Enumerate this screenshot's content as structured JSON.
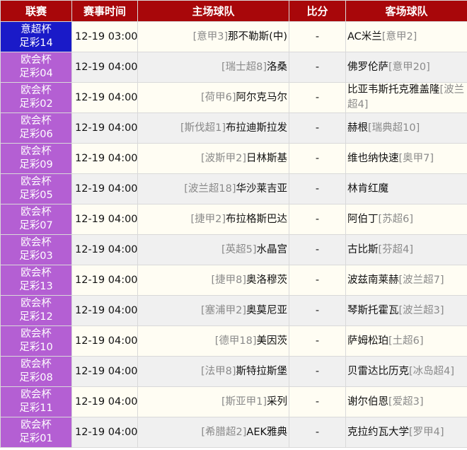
{
  "headers": [
    "联赛",
    "赛事时间",
    "主场球队",
    "比分",
    "客场球队"
  ],
  "colors": {
    "header": "#a8070a",
    "league_italy": "#1a1ac8",
    "league_conference": "#b45fd3"
  },
  "matches": [
    {
      "league": "意超杯",
      "lottery": "足彩14",
      "league_color": "#1a1ac8",
      "time": "12-19 03:00",
      "home_rank": "[意甲3]",
      "home": "那不勒斯(中)",
      "score": "-",
      "away": "AC米兰",
      "away_rank": "[意甲2]"
    },
    {
      "league": "欧会杯",
      "lottery": "足彩04",
      "league_color": "#b45fd3",
      "time": "12-19 04:00",
      "home_rank": "[瑞士超8]",
      "home": "洛桑",
      "score": "-",
      "away": "佛罗伦萨",
      "away_rank": "[意甲20]"
    },
    {
      "league": "欧会杯",
      "lottery": "足彩02",
      "league_color": "#b45fd3",
      "time": "12-19 04:00",
      "home_rank": "[荷甲6]",
      "home": "阿尔克马尔",
      "score": "-",
      "away": "比亚韦斯托克雅盖隆",
      "away_rank": "[波兰超4]"
    },
    {
      "league": "欧会杯",
      "lottery": "足彩06",
      "league_color": "#b45fd3",
      "time": "12-19 04:00",
      "home_rank": "[斯伐超1]",
      "home": "布拉迪斯拉发",
      "score": "-",
      "away": "赫根",
      "away_rank": "[瑞典超10]"
    },
    {
      "league": "欧会杯",
      "lottery": "足彩09",
      "league_color": "#b45fd3",
      "time": "12-19 04:00",
      "home_rank": "[波斯甲2]",
      "home": "日林斯基",
      "score": "-",
      "away": "维也纳快速",
      "away_rank": "[奥甲7]"
    },
    {
      "league": "欧会杯",
      "lottery": "足彩05",
      "league_color": "#b45fd3",
      "time": "12-19 04:00",
      "home_rank": "[波兰超18]",
      "home": "华沙莱吉亚",
      "score": "-",
      "away": "林肯红魔",
      "away_rank": ""
    },
    {
      "league": "欧会杯",
      "lottery": "足彩07",
      "league_color": "#b45fd3",
      "time": "12-19 04:00",
      "home_rank": "[捷甲2]",
      "home": "布拉格斯巴达",
      "score": "-",
      "away": "阿伯丁",
      "away_rank": "[苏超6]"
    },
    {
      "league": "欧会杯",
      "lottery": "足彩03",
      "league_color": "#b45fd3",
      "time": "12-19 04:00",
      "home_rank": "[英超5]",
      "home": "水晶宫",
      "score": "-",
      "away": "古比斯",
      "away_rank": "[芬超4]"
    },
    {
      "league": "欧会杯",
      "lottery": "足彩13",
      "league_color": "#b45fd3",
      "time": "12-19 04:00",
      "home_rank": "[捷甲8]",
      "home": "奥洛穆茨",
      "score": "-",
      "away": "波兹南莱赫",
      "away_rank": "[波兰超7]"
    },
    {
      "league": "欧会杯",
      "lottery": "足彩12",
      "league_color": "#b45fd3",
      "time": "12-19 04:00",
      "home_rank": "[塞浦甲2]",
      "home": "奥莫尼亚",
      "score": "-",
      "away": "琴斯托霍瓦",
      "away_rank": "[波兰超3]"
    },
    {
      "league": "欧会杯",
      "lottery": "足彩10",
      "league_color": "#b45fd3",
      "time": "12-19 04:00",
      "home_rank": "[德甲18]",
      "home": "美因茨",
      "score": "-",
      "away": "萨姆松珀",
      "away_rank": "[土超6]"
    },
    {
      "league": "欧会杯",
      "lottery": "足彩08",
      "league_color": "#b45fd3",
      "time": "12-19 04:00",
      "home_rank": "[法甲8]",
      "home": "斯特拉斯堡",
      "score": "-",
      "away": "贝雷达比历克",
      "away_rank": "[冰岛超4]"
    },
    {
      "league": "欧会杯",
      "lottery": "足彩11",
      "league_color": "#b45fd3",
      "time": "12-19 04:00",
      "home_rank": "[斯亚甲1]",
      "home": "采列",
      "score": "-",
      "away": "谢尔伯恩",
      "away_rank": "[爱超3]"
    },
    {
      "league": "欧会杯",
      "lottery": "足彩01",
      "league_color": "#b45fd3",
      "time": "12-19 04:00",
      "home_rank": "[希腊超2]",
      "home": "AEK雅典",
      "score": "-",
      "away": "克拉约瓦大学",
      "away_rank": "[罗甲4]"
    }
  ]
}
